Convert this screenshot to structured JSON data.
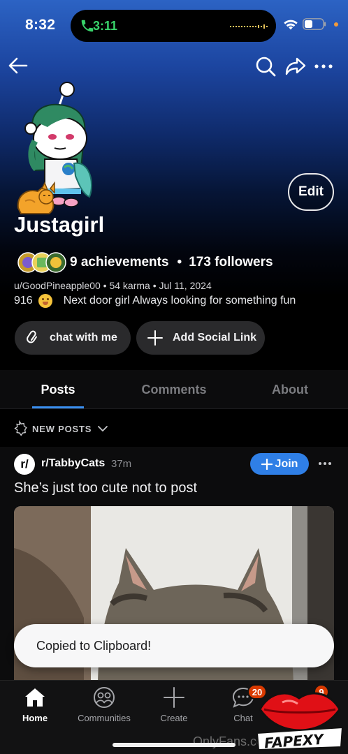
{
  "status_bar": {
    "time": "8:32",
    "call_time": "3:11",
    "call_color": "#38d26a",
    "icons": [
      "phone-icon",
      "wifi-icon",
      "battery-icon"
    ]
  },
  "nav": {
    "icons": [
      "back-arrow-icon",
      "search-icon",
      "share-icon",
      "more-icon"
    ]
  },
  "profile": {
    "display_name": "Justagirl",
    "edit_label": "Edit",
    "achievements": "9 achievements",
    "followers": "173 followers",
    "separator": "•",
    "meta": "u/GoodPineapple00 • 54 karma • Jul 11, 2024",
    "bio_prefix": "916",
    "bio_text": "Next door girl  Always looking for something fun",
    "chat_link_label": "chat with me",
    "add_social_label": "Add Social Link"
  },
  "tabs": [
    {
      "label": "Posts",
      "active": true
    },
    {
      "label": "Comments",
      "active": false
    },
    {
      "label": "About",
      "active": false
    }
  ],
  "sort": {
    "label": "NEW POSTS"
  },
  "post": {
    "subreddit_icon": "r/",
    "subreddit": "r/TabbyCats",
    "age": "37m",
    "join_label": "Join",
    "title": "She’s just too cute not to post"
  },
  "toast": {
    "text": "Copied to Clipboard!"
  },
  "bottom_nav": {
    "items": [
      {
        "label": "Home",
        "icon": "home-icon",
        "active": true
      },
      {
        "label": "Communities",
        "icon": "communities-icon",
        "active": false
      },
      {
        "label": "Create",
        "icon": "plus-icon",
        "active": false
      },
      {
        "label": "Chat",
        "icon": "chat-icon",
        "active": false
      }
    ],
    "chat_badge": "20",
    "inbox_badge": "9"
  },
  "watermark": {
    "text": "OnlyFans.com/...e",
    "logo_text": "FAPEXY"
  },
  "colors": {
    "accent": "#2f7fe6",
    "tab_underline": "#3a8ff0",
    "badge": "#d93a00"
  }
}
